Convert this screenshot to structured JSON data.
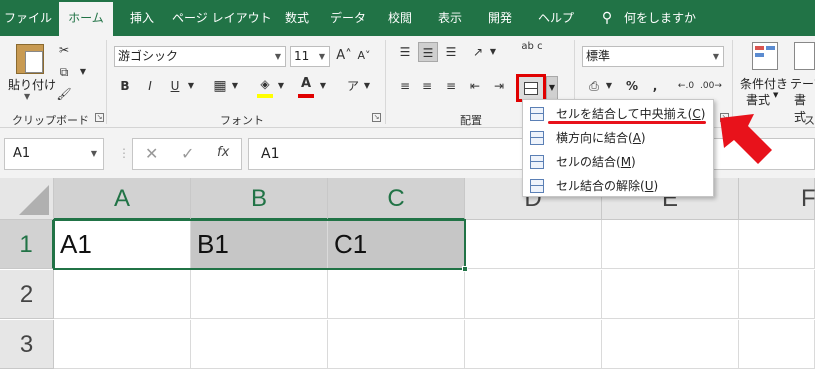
{
  "tabs": [
    "ファイル",
    "ホーム",
    "挿入",
    "ページ レイアウト",
    "数式",
    "データ",
    "校閲",
    "表示",
    "開発",
    "ヘルプ"
  ],
  "tell_me": "何をしますか",
  "clipboard": {
    "paste_label": "貼り付け",
    "group_label": "クリップボード"
  },
  "font": {
    "name": "游ゴシック",
    "size": "11",
    "group_label": "フォント",
    "bold": "B",
    "italic": "I",
    "underline": "U",
    "font_color_glyph": "A",
    "highlight_color": "#ffff00",
    "font_color": "#e00000"
  },
  "alignment": {
    "group_label": "配置",
    "wrap_glyph": "ab c",
    "merge_highlight_color": "#e00000"
  },
  "number": {
    "format": "標準",
    "percent": "%",
    "comma": ","
  },
  "styles": {
    "conditional_label": "条件付き",
    "conditional_label2": "書式",
    "table_label": "テーブ",
    "table_label2": "書式",
    "styles_fragment": "ス"
  },
  "namebox": "A1",
  "formula_value": "A1",
  "fx": "fx",
  "merge_menu": [
    {
      "label": "セルを結合して中央揃え(",
      "key": "C",
      "suffix": ")"
    },
    {
      "label": "横方向に結合(",
      "key": "A",
      "suffix": ")"
    },
    {
      "label": "セルの結合(",
      "key": "M",
      "suffix": ")"
    },
    {
      "label": "セル結合の解除(",
      "key": "U",
      "suffix": ")"
    }
  ],
  "columns": [
    "A",
    "B",
    "C",
    "D",
    "E",
    "F"
  ],
  "rows": [
    "1",
    "2",
    "3"
  ],
  "cells": {
    "A1": "A1",
    "B1": "B1",
    "C1": "C1"
  },
  "colors": {
    "excel_green": "#217346",
    "annotation_red": "#e8121b",
    "selection_gray": "#c6c6c6"
  }
}
